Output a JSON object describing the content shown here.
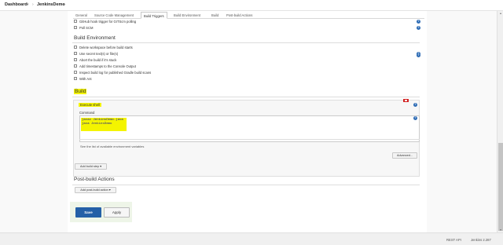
{
  "breadcrumb": {
    "items": [
      "Dashboard",
      "JenkinsDemo"
    ]
  },
  "tabs": [
    "General",
    "Source Code Management",
    "Build Triggers",
    "Build Environment",
    "Build",
    "Post-build Actions"
  ],
  "active_tab": "Build Triggers",
  "build_triggers": {
    "options": [
      "GitHub hook trigger for GITScm polling",
      "Poll SCM"
    ]
  },
  "build_environment": {
    "title": "Build Environment",
    "options": [
      "Delete workspace before build starts",
      "Use secret text(s) or file(s)",
      "Abort the build if it's stuck",
      "Add timestamps to the Console Output",
      "Inspect build log for published Gradle build scans",
      "With Ant"
    ]
  },
  "build": {
    "title": "Build",
    "step_title": "Execute shell",
    "command_label": "Command",
    "command_lines": [
      "javac JenkinsDemo.java",
      "java JenkinsDemo"
    ],
    "env_link": "See the list of available environment variables",
    "advanced_label": "Advanced...",
    "add_step_label": "Add build step"
  },
  "post_build": {
    "title": "Post-build Actions",
    "add_action_label": "Add post-build action"
  },
  "actions": {
    "save": "Save",
    "apply": "Apply"
  },
  "footer": {
    "rest_api": "REST API",
    "version": "Jenkins 2.287"
  },
  "colors": {
    "highlight": "#f4f400",
    "save_button": "#2460a7",
    "help_icon": "#2e6cb5",
    "delete_button": "#d21f1f"
  }
}
